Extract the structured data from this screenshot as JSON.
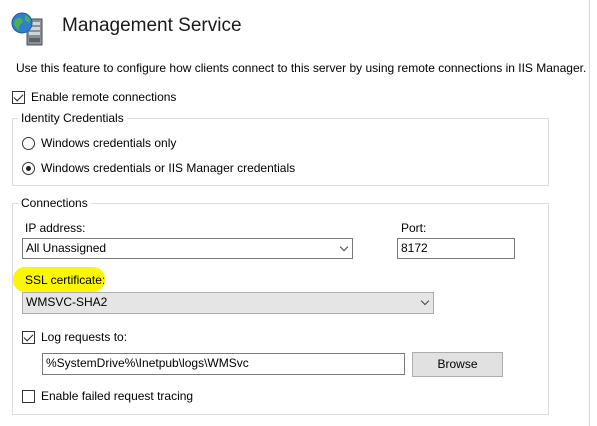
{
  "header": {
    "title": "Management Service",
    "description": "Use this feature to configure how clients connect to this server by using remote connections in IIS Manager.",
    "icon": "server-globe-icon"
  },
  "enable_remote": {
    "label": "Enable remote connections",
    "checked": true
  },
  "identity": {
    "legend": "Identity Credentials",
    "options": [
      {
        "label": "Windows credentials only",
        "selected": false
      },
      {
        "label": "Windows credentials or IIS Manager credentials",
        "selected": true
      }
    ]
  },
  "connections": {
    "legend": "Connections",
    "ip_label": "IP address:",
    "ip_value": "All Unassigned",
    "port_label": "Port:",
    "port_value": "8172",
    "ssl_label": "SSL certificate:",
    "ssl_value": "WMSVC-SHA2",
    "log_label": "Log requests to:",
    "log_checked": true,
    "log_path": "%SystemDrive%\\Inetpub\\logs\\WMSvc",
    "browse_label": "Browse",
    "tracing_label": "Enable failed request tracing",
    "tracing_checked": false
  },
  "colors": {
    "highlight": "#fbf700",
    "group_border": "#dcdcdc"
  }
}
